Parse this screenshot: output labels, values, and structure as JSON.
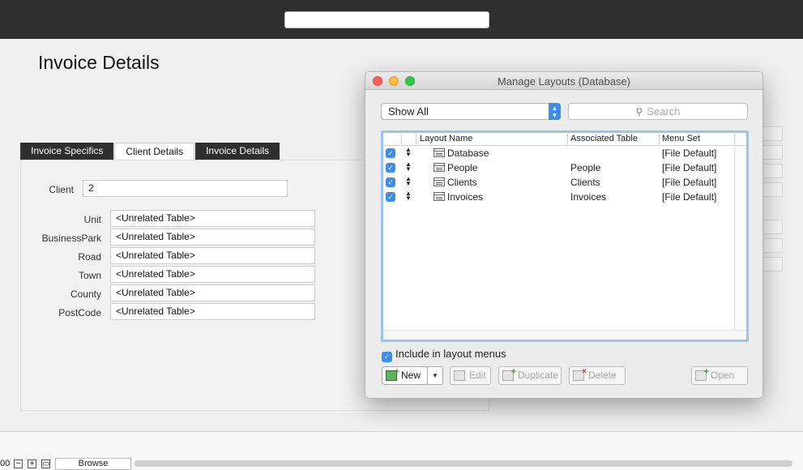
{
  "background": {
    "page_title": "Invoice Details",
    "tabs": [
      {
        "label": "Invoice Specifics",
        "active": false
      },
      {
        "label": "Client Details",
        "active": true
      },
      {
        "label": "Invoice Details",
        "active": false
      }
    ],
    "client_label": "Client",
    "client_value": "2",
    "fields": [
      {
        "label": "Unit",
        "value": "<Unrelated Table>"
      },
      {
        "label": "BusinessPark",
        "value": "<Unrelated Table>"
      },
      {
        "label": "Road",
        "value": "<Unrelated Table>"
      },
      {
        "label": "Town",
        "value": "<Unrelated Table>"
      },
      {
        "label": "County",
        "value": "<Unrelated Table>"
      },
      {
        "label": "PostCode",
        "value": "<Unrelated Table>"
      }
    ]
  },
  "statusbar": {
    "zoom": "00",
    "mode": "Browse"
  },
  "dialog": {
    "title": "Manage Layouts (Database)",
    "filter_selected": "Show All",
    "search_placeholder": "Search",
    "columns": {
      "layout_name": "Layout Name",
      "associated_table": "Associated Table",
      "menu_set": "Menu Set"
    },
    "rows": [
      {
        "name": "Database",
        "table": "",
        "menu_set": "[File Default]",
        "included": true
      },
      {
        "name": "People",
        "table": "People",
        "menu_set": "[File Default]",
        "included": true
      },
      {
        "name": "Clients",
        "table": "Clients",
        "menu_set": "[File Default]",
        "included": true
      },
      {
        "name": "Invoices",
        "table": "Invoices",
        "menu_set": "[File Default]",
        "included": true
      }
    ],
    "include_in_menus_label": "Include in layout menus",
    "include_in_menus_checked": true,
    "buttons": {
      "new": "New",
      "edit": "Edit",
      "duplicate": "Duplicate",
      "delete": "Delete",
      "open": "Open"
    },
    "accent_color": "#3b8ef0"
  }
}
